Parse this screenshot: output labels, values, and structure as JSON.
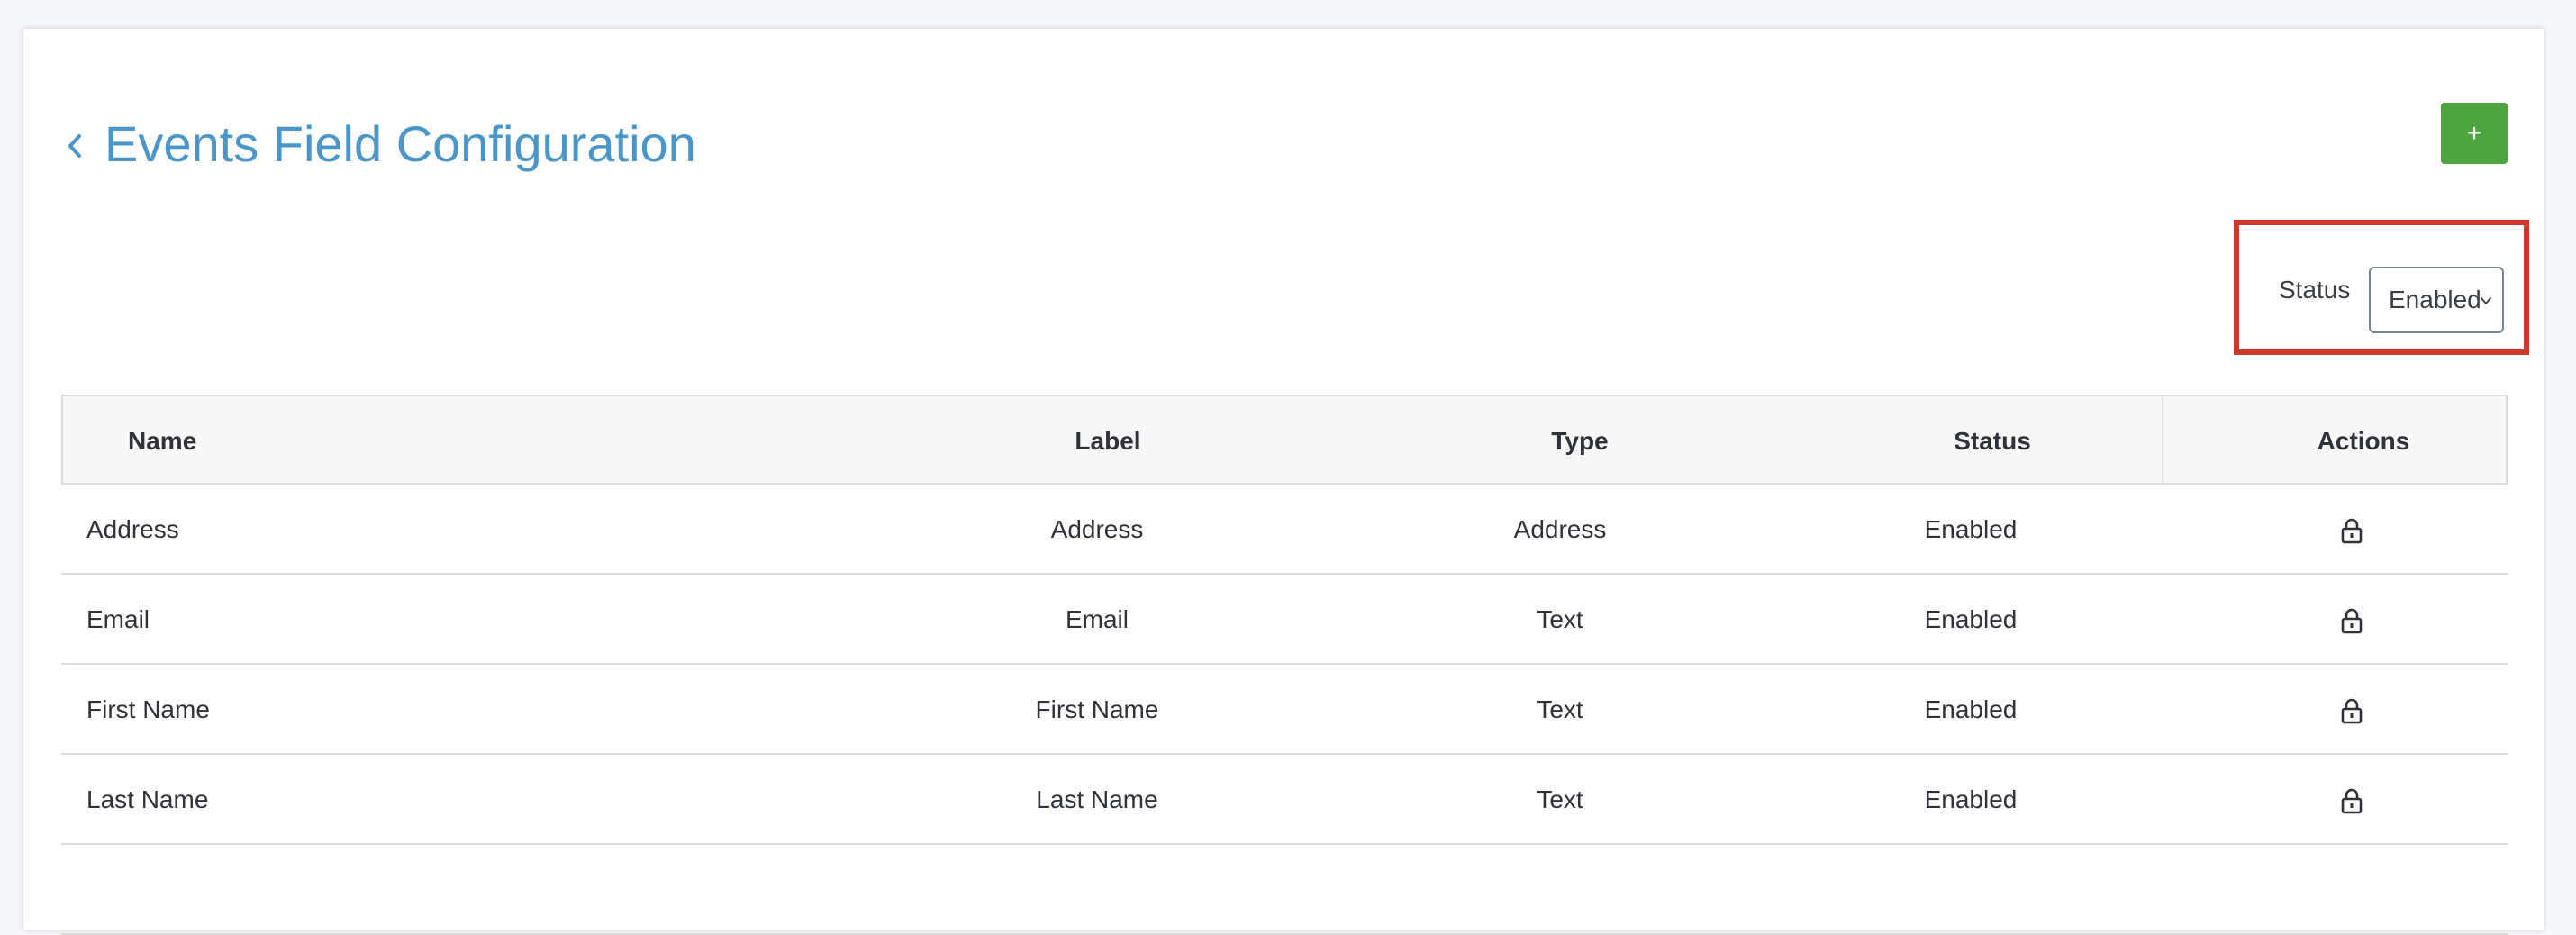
{
  "header": {
    "title": "Events Field Configuration",
    "back_icon": "chevron-left-icon",
    "add_button_label": "+"
  },
  "filter": {
    "label": "Status",
    "selected": "Enabled",
    "dropdown_icon": "chevron-down-icon"
  },
  "table": {
    "columns": [
      "Name",
      "Label",
      "Type",
      "Status",
      "Actions"
    ],
    "rows": [
      {
        "name": "Address",
        "label": "Address",
        "type": "Address",
        "status": "Enabled",
        "action_icon": "lock-icon"
      },
      {
        "name": "Email",
        "label": "Email",
        "type": "Text",
        "status": "Enabled",
        "action_icon": "lock-icon"
      },
      {
        "name": "First Name",
        "label": "First Name",
        "type": "Text",
        "status": "Enabled",
        "action_icon": "lock-icon"
      },
      {
        "name": "Last Name",
        "label": "Last Name",
        "type": "Text",
        "status": "Enabled",
        "action_icon": "lock-icon"
      }
    ]
  },
  "colors": {
    "title": "#4a96c8",
    "add_button": "#4ea43f",
    "highlight": "#cc3a2d"
  }
}
